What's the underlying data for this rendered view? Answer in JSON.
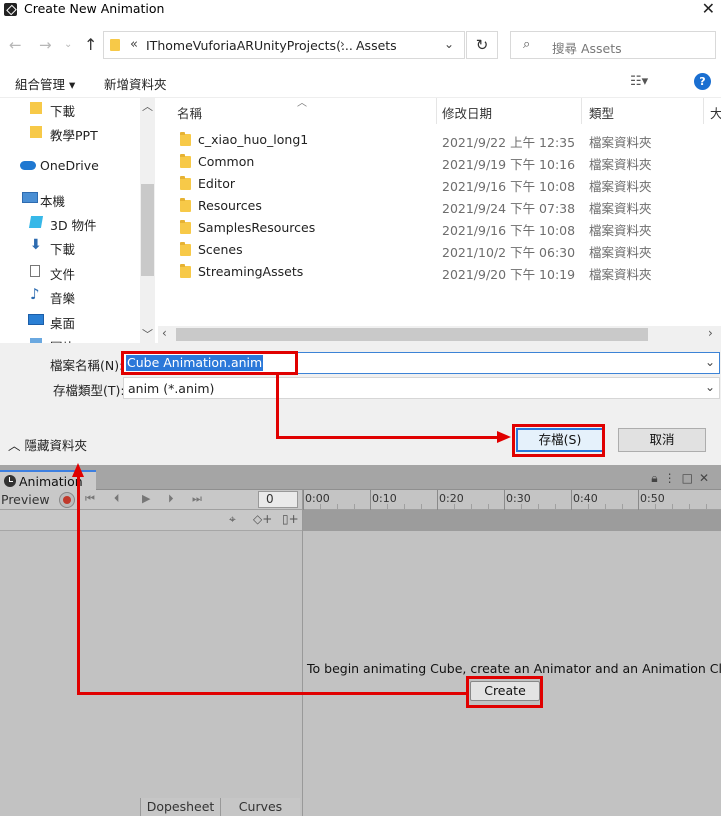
{
  "dialog": {
    "title": "Create New Animation",
    "address": {
      "crumb1": "IThomeVuforiaARUnityProjects(...",
      "crumb2": "Assets"
    },
    "search": {
      "placeholder": "搜尋 Assets"
    },
    "commands": {
      "organize": "組合管理 ▾",
      "new_folder": "新增資料夾"
    },
    "nav_items": [
      {
        "label": "下載",
        "icon": "folder-icon"
      },
      {
        "label": "教學PPT",
        "icon": "folder-icon"
      },
      {
        "label": "OneDrive",
        "icon": "cloud-icon"
      },
      {
        "label": "本機",
        "icon": "computer-icon"
      },
      {
        "label": "3D 物件",
        "icon": "cube-icon"
      },
      {
        "label": "下載",
        "icon": "download-icon"
      },
      {
        "label": "文件",
        "icon": "document-icon"
      },
      {
        "label": "音樂",
        "icon": "music-icon"
      },
      {
        "label": "桌面",
        "icon": "desktop-icon"
      },
      {
        "label": "圖片",
        "icon": "picture-icon"
      }
    ],
    "columns": {
      "name": "名稱",
      "modified": "修改日期",
      "type": "類型",
      "size": "大"
    },
    "files": [
      {
        "name": "c_xiao_huo_long1",
        "modified": "2021/9/22 上午 12:35",
        "type": "檔案資料夾"
      },
      {
        "name": "Common",
        "modified": "2021/9/19 下午 10:16",
        "type": "檔案資料夾"
      },
      {
        "name": "Editor",
        "modified": "2021/9/16 下午 10:08",
        "type": "檔案資料夾"
      },
      {
        "name": "Resources",
        "modified": "2021/9/24 下午 07:38",
        "type": "檔案資料夾"
      },
      {
        "name": "SamplesResources",
        "modified": "2021/9/16 下午 10:08",
        "type": "檔案資料夾"
      },
      {
        "name": "Scenes",
        "modified": "2021/10/2 下午 06:30",
        "type": "檔案資料夾"
      },
      {
        "name": "StreamingAssets",
        "modified": "2021/9/20 下午 10:19",
        "type": "檔案資料夾"
      }
    ],
    "filename_label": "檔案名稱(N):",
    "filename_value": "Cube Animation.anim",
    "filetype_label": "存檔類型(T):",
    "filetype_value": "anim (*.anim)",
    "hide_folders": "隱藏資料夾",
    "save_button": "存檔(S)",
    "cancel_button": "取消"
  },
  "animation": {
    "tab_label": "Animation",
    "preview_label": "Preview",
    "frame_value": "0",
    "ruler_labels": [
      "0:00",
      "0:10",
      "0:20",
      "0:30",
      "0:40",
      "0:50"
    ],
    "message": "To begin animating Cube, create an Animator and an Animation Clip.",
    "create_button": "Create",
    "bottom_tabs": [
      "Dopesheet",
      "Curves"
    ]
  },
  "colors": {
    "annotation": "#e00000",
    "selection": "#2b78d9",
    "unity_panel": "#c2c2c2"
  }
}
